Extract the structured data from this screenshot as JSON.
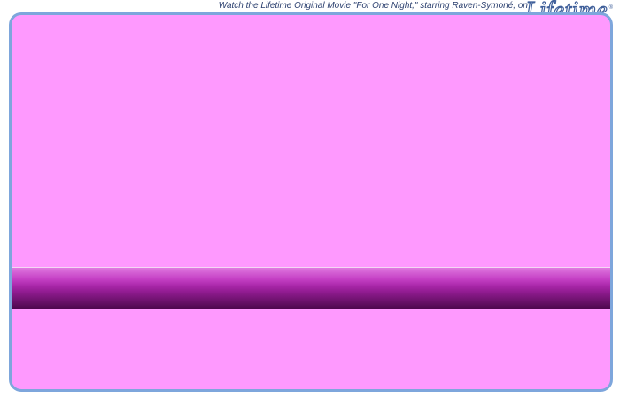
{
  "header": {
    "promo_text": "Watch the Lifetime Original Movie \"For One Night,\" starring Raven-Symoné, on",
    "logo_text": "Lifetime",
    "logo_mark": "®"
  },
  "colors": {
    "panel_background": "#fe99fe",
    "panel_border": "#7ea6dc",
    "band_top": "#e07ae0",
    "band_bottom": "#4c074c"
  }
}
